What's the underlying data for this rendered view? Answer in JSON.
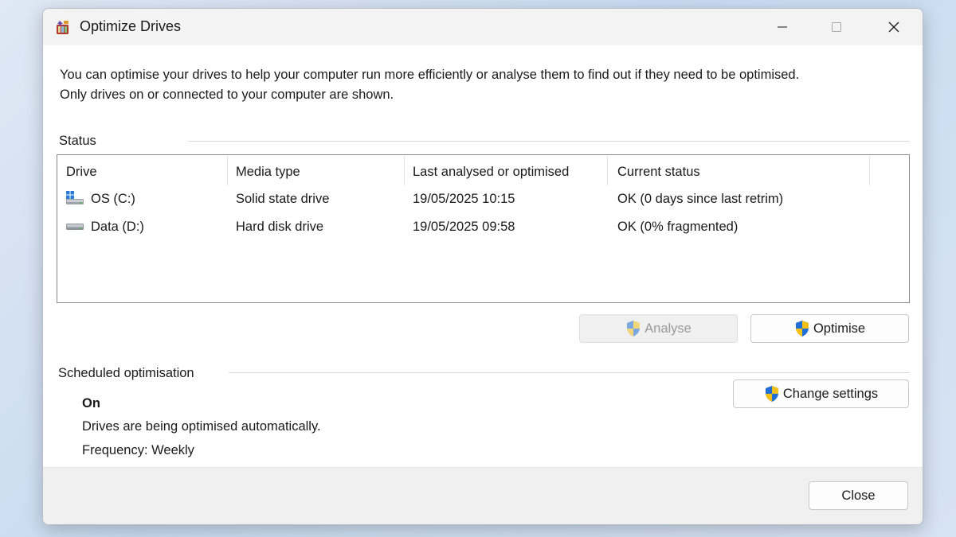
{
  "window": {
    "title": "Optimize Drives"
  },
  "intro": {
    "line1": "You can optimise your drives to help your computer run more efficiently or analyse them to find out if they need to be optimised.",
    "line2": "Only drives on or connected to your computer are shown."
  },
  "status": {
    "label": "Status",
    "columns": [
      "Drive",
      "Media type",
      "Last analysed or optimised",
      "Current status"
    ],
    "rows": [
      {
        "drive": "OS (C:)",
        "media": "Solid state drive",
        "last": "19/05/2025 10:15",
        "status": "OK (0 days since last retrim)",
        "icon": "windows-drive-icon"
      },
      {
        "drive": "Data (D:)",
        "media": "Hard disk drive",
        "last": "19/05/2025 09:58",
        "status": "OK (0% fragmented)",
        "icon": "hard-drive-icon"
      }
    ]
  },
  "buttons": {
    "analyse": "Analyse",
    "optimise": "Optimise",
    "change_settings": "Change settings",
    "close": "Close"
  },
  "scheduled": {
    "label": "Scheduled optimisation",
    "state": "On",
    "description": "Drives are being optimised automatically.",
    "frequency": "Frequency: Weekly"
  },
  "colors": {
    "shield_blue": "#1f6fd6",
    "shield_yellow": "#f2c21a",
    "accent": "#0067c0"
  }
}
